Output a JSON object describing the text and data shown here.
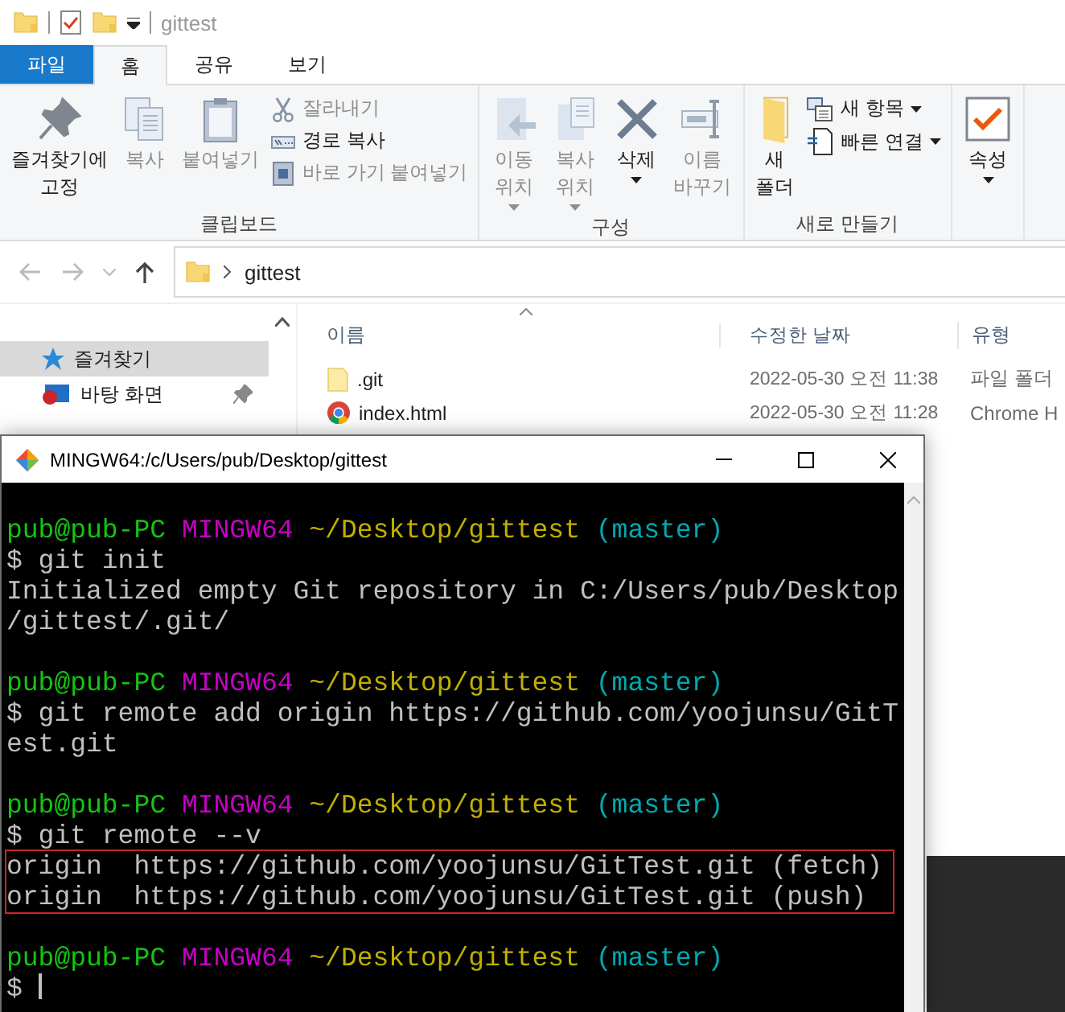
{
  "explorer": {
    "title": "gittest",
    "tabs": [
      {
        "label": "파일",
        "kind": "file",
        "selected": false
      },
      {
        "label": "홈",
        "kind": "tab",
        "selected": true
      },
      {
        "label": "공유",
        "kind": "tab",
        "selected": false
      },
      {
        "label": "보기",
        "kind": "tab",
        "selected": false
      }
    ],
    "ribbon": [
      {
        "label": "클립보드",
        "items": [
          {
            "kind": "large",
            "lines": [
              "즐겨찾기에",
              "고정"
            ],
            "disabled": false,
            "dropdown": false
          },
          {
            "kind": "large",
            "lines": [
              "복사"
            ],
            "disabled": true,
            "dropdown": false
          },
          {
            "kind": "large",
            "lines": [
              "붙여넣기"
            ],
            "disabled": true,
            "dropdown": false
          },
          {
            "kind": "small",
            "lines": [
              "잘라내기"
            ],
            "disabled": true,
            "dropdown": false
          },
          {
            "kind": "small",
            "lines": [
              "경로 복사"
            ],
            "disabled": false,
            "dropdown": false
          },
          {
            "kind": "small",
            "lines": [
              "바로 가기 붙여넣기"
            ],
            "disabled": true,
            "dropdown": false
          }
        ]
      },
      {
        "label": "구성",
        "items": [
          {
            "kind": "large",
            "lines": [
              "이동",
              "위치"
            ],
            "disabled": true,
            "dropdown": true
          },
          {
            "kind": "large",
            "lines": [
              "복사",
              "위치"
            ],
            "disabled": true,
            "dropdown": true
          },
          {
            "kind": "large",
            "lines": [
              "삭제"
            ],
            "disabled": false,
            "dropdown": true
          },
          {
            "kind": "large",
            "lines": [
              "이름",
              "바꾸기"
            ],
            "disabled": true,
            "dropdown": false
          }
        ]
      },
      {
        "label": "새로 만들기",
        "items": [
          {
            "kind": "large",
            "lines": [
              "새",
              "폴더"
            ],
            "disabled": false,
            "dropdown": false
          },
          {
            "kind": "small",
            "lines": [
              "새 항목"
            ],
            "disabled": false,
            "dropdown": true
          },
          {
            "kind": "small",
            "lines": [
              "빠른 연결"
            ],
            "disabled": false,
            "dropdown": true
          }
        ]
      },
      {
        "items": [
          {
            "kind": "large",
            "lines": [
              "속성"
            ],
            "disabled": false,
            "dropdown": true
          }
        ]
      }
    ],
    "address": {
      "path": "gittest"
    },
    "nav": [
      {
        "label": "즐겨찾기",
        "selected": true,
        "pinned": false
      },
      {
        "label": "바탕 화면",
        "selected": false,
        "pinned": true
      }
    ],
    "columns": [
      "이름",
      "수정한 날짜",
      "유형"
    ],
    "files": [
      {
        "kind": "folder",
        "name": ".git",
        "modified": "2022-05-30 오전 11:38",
        "type": "파일 폴더"
      },
      {
        "kind": "chrome",
        "name": "index.html",
        "modified": "2022-05-30 오전 11:28",
        "type": "Chrome H"
      }
    ]
  },
  "terminal": {
    "title": "MINGW64:/c/Users/pub/Desktop/gittest",
    "lines": [
      {
        "kind": "prompt",
        "user": "pub@pub-PC",
        "system": "MINGW64",
        "path": "~/Desktop/gittest",
        "branch": "(master)",
        "highlighted": false
      },
      {
        "kind": "text",
        "text": "$ git init",
        "highlighted": false
      },
      {
        "kind": "text",
        "text": "Initialized empty Git repository in C:/Users/pub/Desktop",
        "highlighted": false
      },
      {
        "kind": "text",
        "text": "/gittest/.git/",
        "highlighted": false
      },
      {
        "kind": "blank"
      },
      {
        "kind": "prompt",
        "user": "pub@pub-PC",
        "system": "MINGW64",
        "path": "~/Desktop/gittest",
        "branch": "(master)",
        "highlighted": false
      },
      {
        "kind": "text",
        "text": "$ git remote add origin https://github.com/yoojunsu/GitT",
        "highlighted": false
      },
      {
        "kind": "text",
        "text": "est.git",
        "highlighted": false
      },
      {
        "kind": "blank"
      },
      {
        "kind": "prompt",
        "user": "pub@pub-PC",
        "system": "MINGW64",
        "path": "~/Desktop/gittest",
        "branch": "(master)",
        "highlighted": false
      },
      {
        "kind": "text",
        "text": "$ git remote --v",
        "highlighted": false
      },
      {
        "kind": "text",
        "text": "origin  https://github.com/yoojunsu/GitTest.git (fetch)",
        "highlighted": true
      },
      {
        "kind": "text",
        "text": "origin  https://github.com/yoojunsu/GitTest.git (push)",
        "highlighted": true
      },
      {
        "kind": "blank"
      },
      {
        "kind": "prompt",
        "user": "pub@pub-PC",
        "system": "MINGW64",
        "path": "~/Desktop/gittest",
        "branch": "(master)",
        "highlighted": false
      },
      {
        "kind": "cursor",
        "text": "$",
        "highlighted": false
      }
    ]
  }
}
